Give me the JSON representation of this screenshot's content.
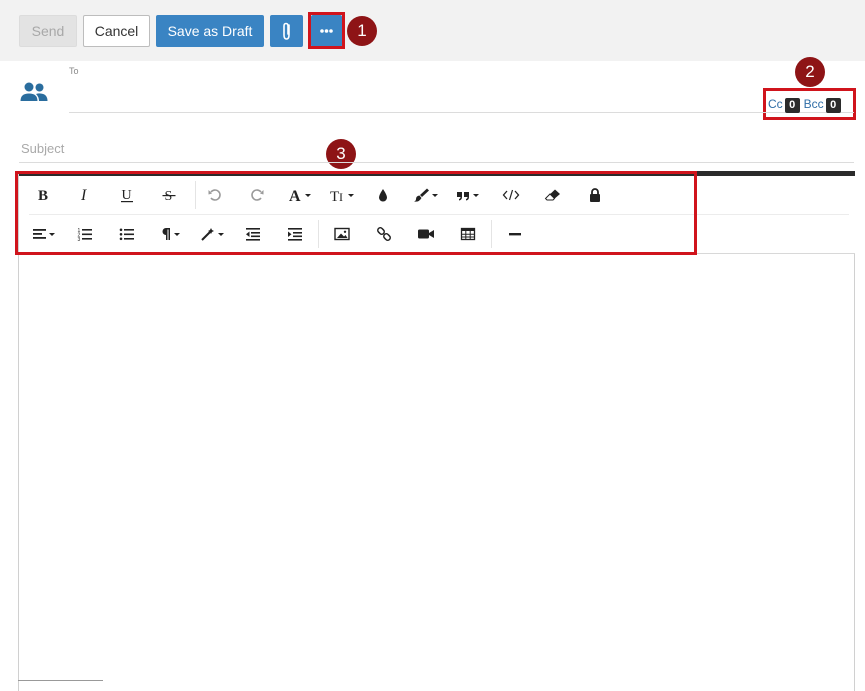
{
  "toolbar": {
    "send_label": "Send",
    "cancel_label": "Cancel",
    "draft_label": "Save as Draft"
  },
  "callouts": [
    "1",
    "2",
    "3"
  ],
  "recipients": {
    "to_label": "To",
    "cc_label": "Cc",
    "cc_count": "0",
    "bcc_label": "Bcc",
    "bcc_count": "0"
  },
  "subject": {
    "placeholder": "Subject"
  },
  "editor_toolbar": {
    "row1": [
      "bold",
      "italic",
      "underline",
      "strikethrough",
      "undo",
      "redo",
      "font-name",
      "font-size",
      "text-color",
      "highlight",
      "blockquote",
      "code",
      "clear-format",
      "lock"
    ],
    "row2": [
      "align",
      "ordered-list",
      "unordered-list",
      "paragraph",
      "magic-style",
      "outdent",
      "indent",
      "image",
      "link",
      "video",
      "table",
      "horizontal-rule"
    ]
  },
  "colors": {
    "primary": "#3a84c3",
    "callout": "#8e1416",
    "highlight_box": "#d0141c",
    "link": "#2f6ea6",
    "people_icon": "#2a6d9e"
  }
}
